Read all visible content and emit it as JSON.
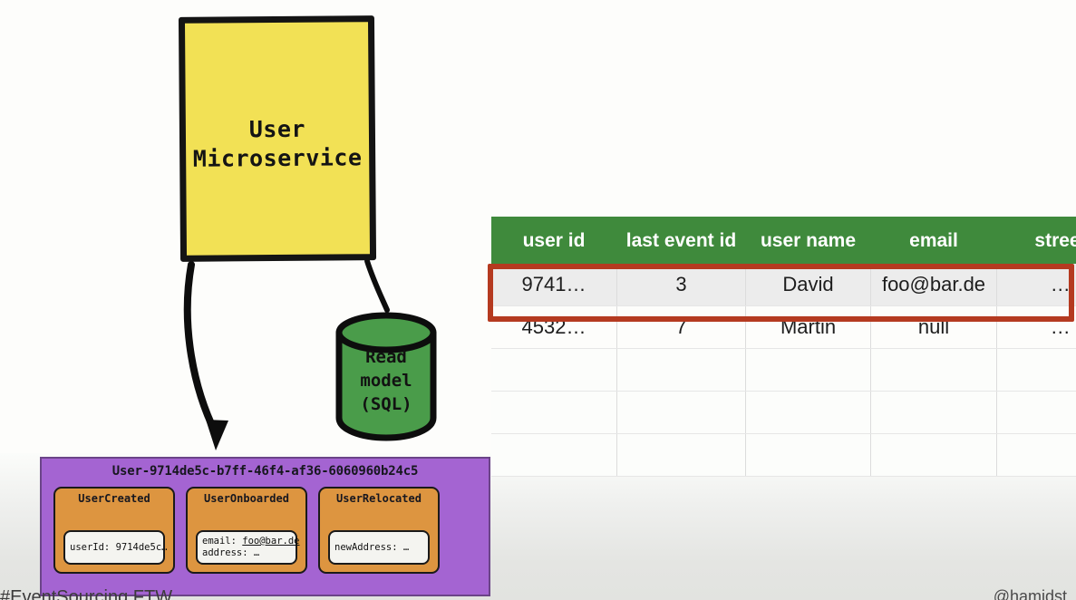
{
  "slide": {
    "background_color": "#fdfdfb",
    "bottom_band_color": "#e4e5e2"
  },
  "service": {
    "label": "User\nMicroservice",
    "fill_color": "#f2e155",
    "stroke_color": "#141414"
  },
  "read_model": {
    "label": "Read\nmodel\n(SQL)",
    "fill_color": "#4a9c4a",
    "stroke_color": "#121212"
  },
  "arrows": {
    "to_event_stream_name": "curved-arrow-to-event-stream",
    "to_read_model_name": "line-to-read-model",
    "color": "#0d0d0d"
  },
  "table": {
    "header_color": "#3f8a3c",
    "highlight_color": "#b53a20",
    "columns": [
      "user id",
      "last event id",
      "user name",
      "email",
      "street"
    ],
    "rows": [
      {
        "state": "active",
        "cells": [
          "9741…",
          "3",
          "David",
          "foo@bar.de",
          "…"
        ]
      },
      {
        "state": "faded",
        "cells": [
          "4532…",
          "7",
          "Martin",
          "null",
          "…"
        ]
      },
      {
        "state": "empty",
        "cells": [
          "",
          "",
          "",
          "",
          ""
        ]
      },
      {
        "state": "empty",
        "cells": [
          "",
          "",
          "",
          "",
          ""
        ]
      },
      {
        "state": "empty",
        "cells": [
          "",
          "",
          "",
          "",
          ""
        ]
      }
    ]
  },
  "event_stream": {
    "title": "User-9714de5c-b7ff-46f4-af36-6060960b24c5",
    "fill_color": "#a464d2",
    "card_color": "#dd9540",
    "events": [
      {
        "name": "UserCreated",
        "fields": [
          {
            "text": "userId: 9714de5c…",
            "link": ""
          }
        ]
      },
      {
        "name": "UserOnboarded",
        "fields": [
          {
            "text": "email: ",
            "link": "foo@bar.de"
          },
          {
            "text": "address: …",
            "link": ""
          }
        ]
      },
      {
        "name": "UserRelocated",
        "fields": [
          {
            "text": "newAddress: …",
            "link": ""
          }
        ]
      }
    ]
  },
  "footer": {
    "left": "#EventSourcing FTW",
    "right": "@hamidst"
  }
}
